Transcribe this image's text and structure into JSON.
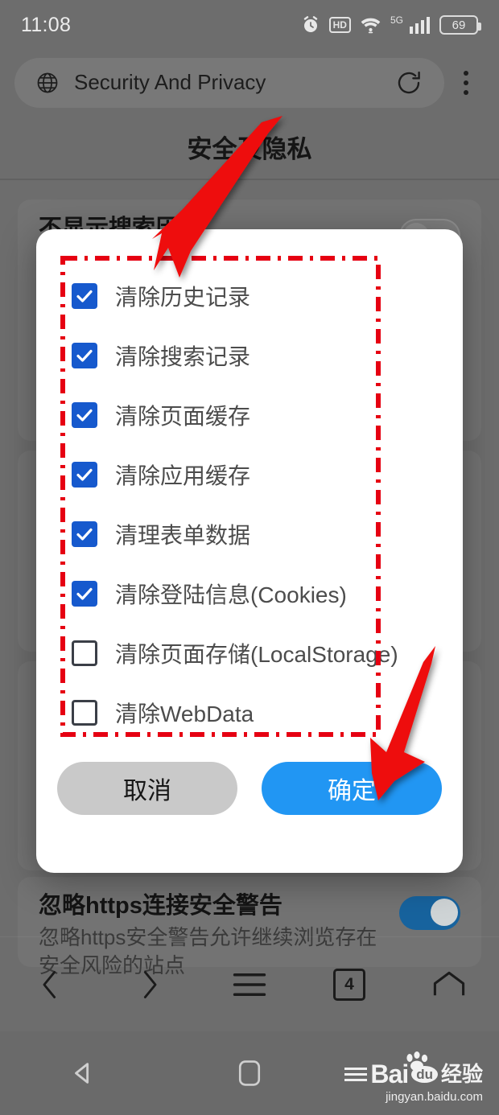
{
  "statusbar": {
    "time": "11:08",
    "icons": [
      "alarm-clock-icon",
      "hd-icon",
      "wifi-icon",
      "5g-signal-icon",
      "battery-icon"
    ],
    "hd_label": "HD",
    "network_label": "5G",
    "battery_level": "69"
  },
  "browser": {
    "url_text": "Security And Privacy",
    "globe_icon": "globe-icon",
    "reload_icon": "reload-icon",
    "menu_icon": "kebab-menu-icon",
    "nav": {
      "back_icon": "chevron-left-icon",
      "forward_icon": "chevron-right-icon",
      "menu_icon": "hamburger-menu-icon",
      "tab_count": "4",
      "home_icon": "home-icon"
    }
  },
  "page": {
    "title": "安全及隐私",
    "settings": [
      {
        "title": "不显示搜索历史",
        "desc": "",
        "toggle": "off"
      },
      {
        "title": "",
        "desc": "",
        "toggle": "on"
      },
      {
        "title": "",
        "desc": "",
        "toggle": "on"
      },
      {
        "title": "忽略https连接安全警告",
        "desc": "忽略https安全警告允许继续浏览存在安全风险的站点",
        "toggle": "on"
      }
    ]
  },
  "dialog": {
    "checkboxes": [
      {
        "label": "清除历史记录",
        "checked": true
      },
      {
        "label": "清除搜索记录",
        "checked": true
      },
      {
        "label": "清除页面缓存",
        "checked": true
      },
      {
        "label": "清除应用缓存",
        "checked": true
      },
      {
        "label": "清理表单数据",
        "checked": true
      },
      {
        "label": "清除登陆信息(Cookies)",
        "checked": true
      },
      {
        "label": "清除页面存储(LocalStorage)",
        "checked": false
      },
      {
        "label": "清除WebData",
        "checked": false
      }
    ],
    "cancel_label": "取消",
    "confirm_label": "确定"
  },
  "system_nav": {
    "back_icon": "triangle-back-icon",
    "home_icon": "square-home-icon"
  },
  "watermark": {
    "brand": "Bai",
    "brand_suffix": "du",
    "product": "经验",
    "url": "jingyan.baidu.com"
  },
  "colors": {
    "checkbox_blue": "#1659cd",
    "confirm_blue": "#2196f3",
    "cancel_gray": "#c9c9c9",
    "annotation_red": "#e60012",
    "toggle_on": "#17639e",
    "backdrop": "#6d6d6d"
  }
}
